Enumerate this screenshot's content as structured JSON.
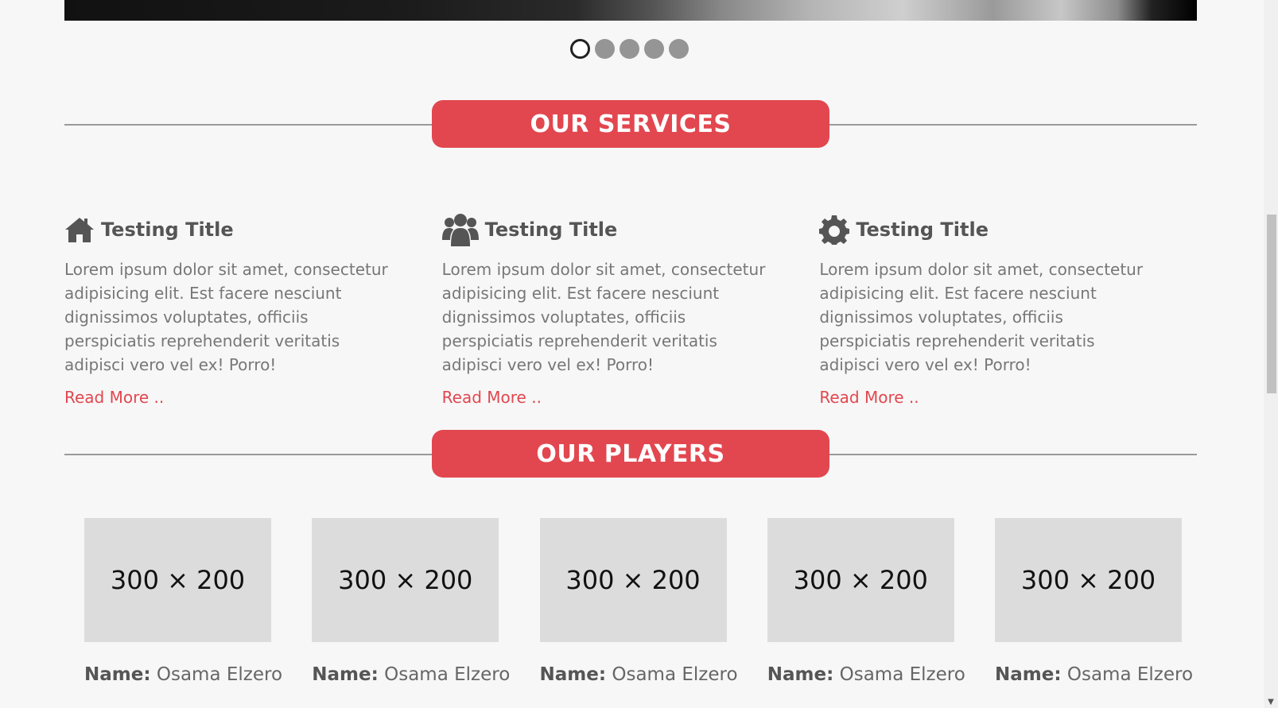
{
  "slider": {
    "dots": [
      {
        "active": true
      },
      {
        "active": false
      },
      {
        "active": false
      },
      {
        "active": false
      },
      {
        "active": false
      }
    ]
  },
  "services": {
    "heading": "OUR SERVICES",
    "items": [
      {
        "icon": "home-icon",
        "title": "Testing Title",
        "text": "Lorem ipsum dolor sit amet, consectetur adipisicing elit. Est facere nesciunt dignissimos voluptates, officiis perspiciatis reprehenderit veritatis adipisci vero vel ex! Porro!",
        "link": "Read More .."
      },
      {
        "icon": "users-icon",
        "title": "Testing Title",
        "text": "Lorem ipsum dolor sit amet, consectetur adipisicing elit. Est facere nesciunt dignissimos voluptates, officiis perspiciatis reprehenderit veritatis adipisci vero vel ex! Porro!",
        "link": "Read More .."
      },
      {
        "icon": "gear-icon",
        "title": "Testing Title",
        "text": "Lorem ipsum dolor sit amet, consectetur adipisicing elit. Est facere nesciunt dignissimos voluptates, officiis perspiciatis reprehenderit veritatis adipisci vero vel ex! Porro!",
        "link": "Read More .."
      }
    ]
  },
  "players": {
    "heading": "OUR PLAYERS",
    "name_label": "Name:",
    "items": [
      {
        "image_text": "300 × 200",
        "name": "Osama Elzero"
      },
      {
        "image_text": "300 × 200",
        "name": "Osama Elzero"
      },
      {
        "image_text": "300 × 200",
        "name": "Osama Elzero"
      },
      {
        "image_text": "300 × 200",
        "name": "Osama Elzero"
      },
      {
        "image_text": "300 × 200",
        "name": "Osama Elzero"
      }
    ]
  },
  "colors": {
    "accent": "#e2474f",
    "background": "#f7f7f7",
    "text": "#777777"
  },
  "scrollbar": {
    "arrow_icon": "arrow-down-icon"
  }
}
